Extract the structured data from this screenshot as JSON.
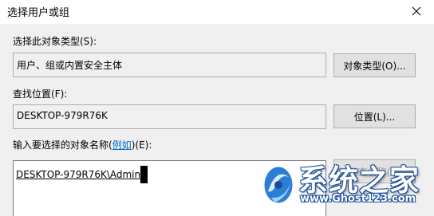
{
  "window": {
    "title": "选择用户或组",
    "close_icon": "close-icon"
  },
  "object_type": {
    "label": "选择此对象类型(S):",
    "value": "用户、组或内置安全主体",
    "button": "对象类型(O)..."
  },
  "location": {
    "label": "查找位置(F):",
    "value": "DESKTOP-979R76K",
    "button": "位置(L)..."
  },
  "names": {
    "label_prefix": "输入要选择的对象名称(",
    "label_link": "例如",
    "label_suffix": ")(E):",
    "value": "DESKTOP-979R76K\\Admin",
    "check_button": "检查名称(C)"
  },
  "watermark": {
    "text": "系统之家",
    "url": "www.Ghost123.com"
  },
  "colors": {
    "dialog_bg": "#f0f0f0",
    "link": "#0066cc",
    "watermark_blue": "#1a4e9a"
  }
}
